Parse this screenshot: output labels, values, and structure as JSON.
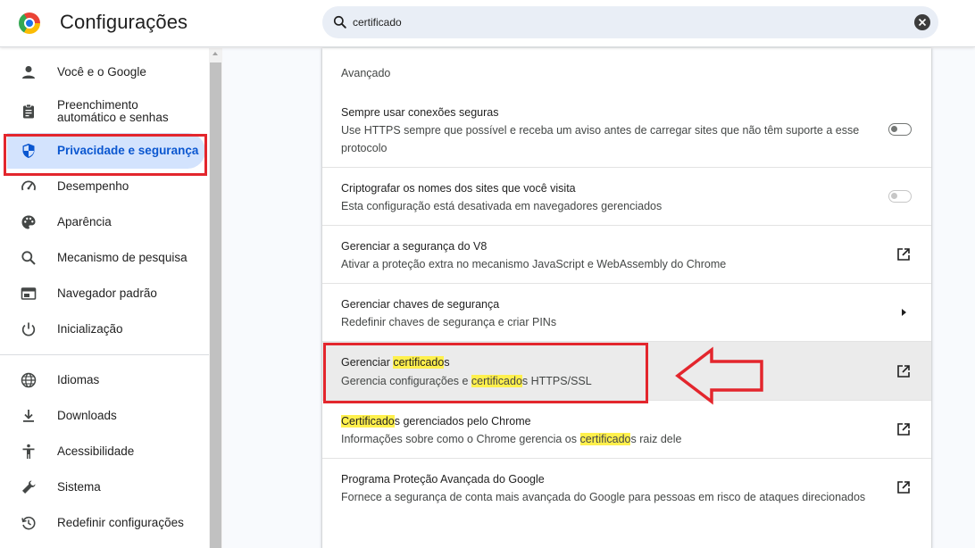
{
  "header": {
    "title": "Configurações",
    "search_value": "certificado"
  },
  "sidebar": {
    "items": [
      {
        "label": "Você e o Google",
        "icon": "person-icon"
      },
      {
        "label": "Preenchimento automático e senhas",
        "icon": "clipboard-icon"
      },
      {
        "label": "Privacidade e segurança",
        "icon": "shield-icon",
        "active": true
      },
      {
        "label": "Desempenho",
        "icon": "speedometer-icon"
      },
      {
        "label": "Aparência",
        "icon": "palette-icon"
      },
      {
        "label": "Mecanismo de pesquisa",
        "icon": "search-icon"
      },
      {
        "label": "Navegador padrão",
        "icon": "browser-window-icon"
      },
      {
        "label": "Inicialização",
        "icon": "power-icon"
      },
      {
        "label": "Idiomas",
        "icon": "globe-icon"
      },
      {
        "label": "Downloads",
        "icon": "download-icon"
      },
      {
        "label": "Acessibilidade",
        "icon": "accessibility-icon"
      },
      {
        "label": "Sistema",
        "icon": "wrench-icon"
      },
      {
        "label": "Redefinir configurações",
        "icon": "restore-icon"
      }
    ]
  },
  "main": {
    "section_title": "Avançado",
    "rows": [
      {
        "title": "Sempre usar conexões seguras",
        "desc_line1": "Use HTTPS sempre que possível e receba um aviso antes de carregar sites que não têm suporte a esse",
        "desc_line2": "protocolo",
        "control": "toggle-off"
      },
      {
        "title": "Criptografar os nomes dos sites que você visita",
        "desc": "Esta configuração está desativada em navegadores gerenciados",
        "control": "toggle-disabled"
      },
      {
        "title": "Gerenciar a segurança do V8",
        "desc": "Ativar a proteção extra no mecanismo JavaScript e WebAssembly do Chrome",
        "control": "external-link-icon"
      },
      {
        "title": "Gerenciar chaves de segurança",
        "desc": "Redefinir chaves de segurança e criar PINs",
        "control": "chevron-right-icon"
      },
      {
        "title_pre": "Gerenciar ",
        "title_hl": "certificado",
        "title_post": "s",
        "desc_pre": "Gerencia configurações e ",
        "desc_hl": "certificado",
        "desc_post": "s HTTPS/SSL",
        "control": "external-link-icon"
      },
      {
        "title_hl": "Certificado",
        "title_post": "s gerenciados pelo Chrome",
        "desc_pre": "Informações sobre como o Chrome gerencia os ",
        "desc_hl": "certificado",
        "desc_post": "s raiz dele",
        "control": "external-link-icon"
      },
      {
        "title": "Programa Proteção Avançada do Google",
        "desc": "Fornece a segurança de conta mais avançada do Google para pessoas em risco de ataques direcionados",
        "control": "external-link-icon"
      }
    ]
  },
  "colors": {
    "accent": "#0b57d0",
    "active_bg": "#d3e3fd",
    "annotation_red": "#e3262d",
    "highlight_yellow": "#fff04d"
  }
}
